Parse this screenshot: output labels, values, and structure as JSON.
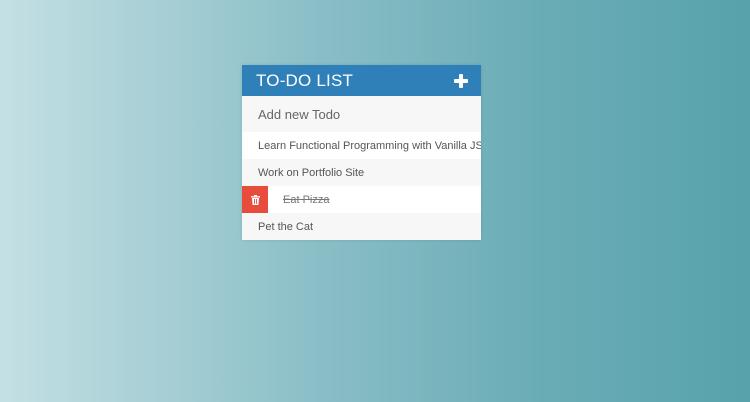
{
  "header": {
    "title": "TO-DO LIST"
  },
  "input": {
    "placeholder": "Add new Todo"
  },
  "todos": [
    {
      "text": "Learn Functional Programming with Vanilla JS",
      "completed": false
    },
    {
      "text": "Work on Portfolio Site",
      "completed": false
    },
    {
      "text": "Eat Pizza",
      "completed": true
    },
    {
      "text": "Pet the Cat",
      "completed": false
    }
  ],
  "colors": {
    "header": "#2f80b9",
    "delete": "#e84c3d"
  },
  "icons": {
    "add": "plus-icon",
    "delete": "trash-icon"
  }
}
